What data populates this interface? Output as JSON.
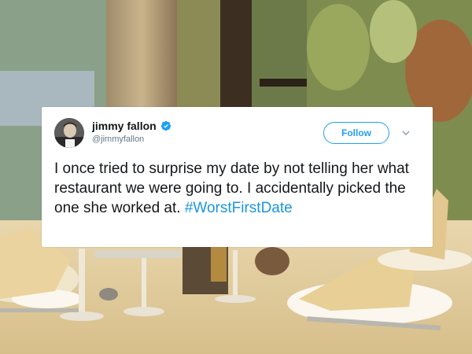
{
  "tweet": {
    "display_name": "jimmy fallon",
    "handle": "@jimmyfallon",
    "follow_label": "Follow",
    "text": "I once tried to surprise my date by not telling her what restaurant we were going to. I accidentally picked the one she worked at.",
    "hashtag": "#WorstFirstDate",
    "verified": true,
    "accent_color": "#1da1f2",
    "hashtag_color": "#1b95e0"
  },
  "icons": {
    "verified": "verified-badge-icon",
    "chevron": "chevron-down-icon",
    "avatar": "avatar"
  }
}
